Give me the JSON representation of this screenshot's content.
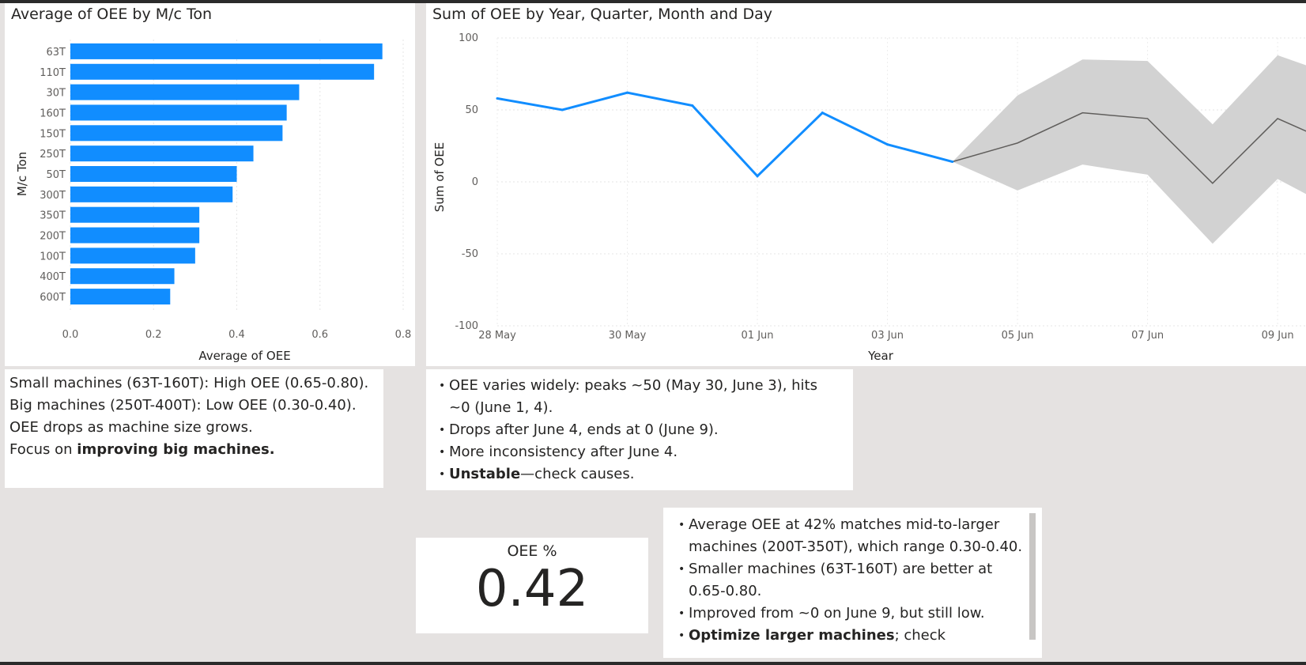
{
  "bar_visual": {
    "title": "Average of OEE by M/c Ton",
    "xlabel": "Average of OEE",
    "ylabel": "M/c Ton",
    "x_ticks": [
      "0.0",
      "0.2",
      "0.4",
      "0.6",
      "0.8"
    ]
  },
  "line_visual": {
    "title": "Sum of OEE by Year, Quarter, Month and Day",
    "xlabel": "Year",
    "ylabel": "Sum of OEE",
    "y_ticks": [
      "100",
      "50",
      "0",
      "-50",
      "-100"
    ],
    "x_ticks": [
      "28 May",
      "30 May",
      "01 Jun",
      "03 Jun",
      "05 Jun",
      "07 Jun",
      "09 Jun"
    ]
  },
  "chart_data": [
    {
      "type": "bar",
      "orientation": "horizontal",
      "title": "Average of OEE by M/c Ton",
      "xlabel": "Average of OEE",
      "ylabel": "M/c Ton",
      "categories": [
        "63T",
        "110T",
        "30T",
        "160T",
        "150T",
        "250T",
        "50T",
        "300T",
        "350T",
        "200T",
        "100T",
        "400T",
        "600T"
      ],
      "values": [
        0.75,
        0.73,
        0.55,
        0.52,
        0.51,
        0.44,
        0.4,
        0.39,
        0.31,
        0.31,
        0.3,
        0.25,
        0.24
      ],
      "xlim": [
        0,
        0.8
      ],
      "grid": true,
      "color": "#118DFF"
    },
    {
      "type": "line",
      "title": "Sum of OEE by Year, Quarter, Month and Day",
      "xlabel": "Year",
      "ylabel": "Sum of OEE",
      "ylim": [
        -100,
        100
      ],
      "xlim": [
        "2024-05-28",
        "2024-06-09"
      ],
      "grid": true,
      "series": [
        {
          "x": [
            "2024-05-28",
            "2024-05-29",
            "2024-05-30",
            "2024-05-31",
            "2024-06-01",
            "2024-06-02",
            "2024-06-03",
            "2024-06-04"
          ],
          "values": [
            58,
            50,
            62,
            53,
            4,
            48,
            26,
            14
          ],
          "color": "#118DFF"
        }
      ],
      "forecast": {
        "x": [
          "2024-06-04",
          "2024-06-05",
          "2024-06-06",
          "2024-06-07",
          "2024-06-08",
          "2024-06-09",
          "2024-06-10"
        ],
        "values": [
          14,
          27,
          48,
          44,
          -1,
          44,
          24
        ],
        "upper": [
          14,
          60,
          85,
          84,
          40,
          88,
          72
        ],
        "lower": [
          14,
          -6,
          12,
          5,
          -43,
          2,
          -22
        ],
        "line_color": "#605e5c",
        "band_color": "#d2d2d2"
      }
    }
  ],
  "textbox1": {
    "line1": "Small machines (63T-160T): High OEE (0.65-0.80).",
    "line2": "Big machines (250T-400T): Low OEE (0.30-0.40).",
    "line3": "OEE drops as machine size grows.",
    "line4_prefix": "Focus on ",
    "line4_bold": "improving big machines."
  },
  "textbox2": {
    "b1": "OEE varies widely: peaks ~50 (May 30, June 3), hits ~0 (June 1, 4).",
    "b2": "Drops after June 4, ends at 0 (June 9).",
    "b3": "More inconsistency after June 4.",
    "b4_bold": "Unstable",
    "b4_rest": "—check causes."
  },
  "kpi": {
    "label": "OEE %",
    "value": "0.42"
  },
  "textbox3": {
    "b1": "Average OEE at 42% matches mid-to-larger machines (200T-350T), which range 0.30-0.40.",
    "b2": "Smaller machines (63T-160T) are better at 0.65-0.80.",
    "b3": "Improved from ~0 on June 9, but still low.",
    "b4_bold": "Optimize larger machines",
    "b4_rest": "; check"
  }
}
